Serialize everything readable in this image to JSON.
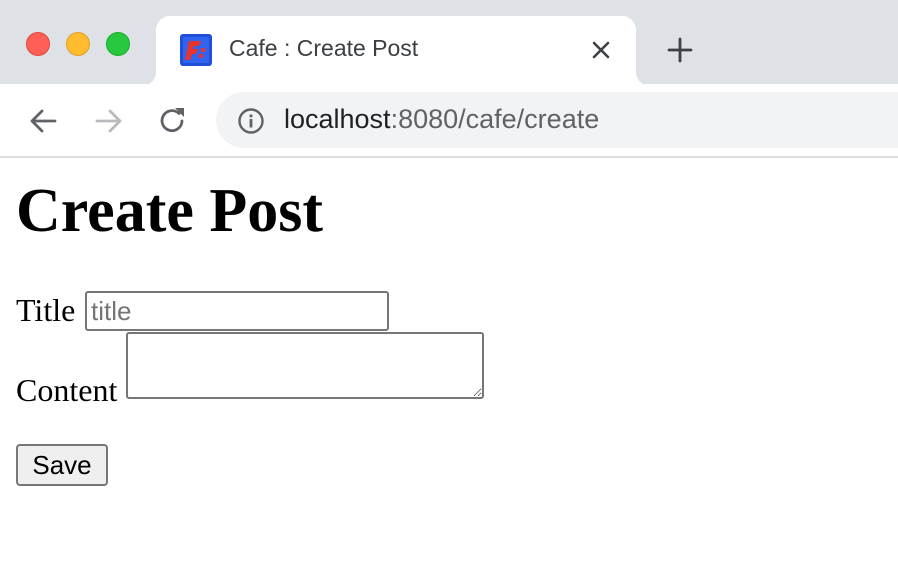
{
  "browser": {
    "tab": {
      "title": "Cafe : Create Post",
      "favicon": "cafe-favicon-icon"
    },
    "address_bar": {
      "host": "localhost",
      "rest": ":8080/cafe/create"
    },
    "colors": {
      "tabstrip": "#dee1e6",
      "close": "#ff5f57",
      "minimize": "#febc2e",
      "maximize": "#28c840"
    }
  },
  "page": {
    "heading": "Create Post",
    "form": {
      "title_label": "Title",
      "title_placeholder": "title",
      "title_value": "",
      "content_label": "Content",
      "content_value": "",
      "save_label": "Save"
    }
  }
}
